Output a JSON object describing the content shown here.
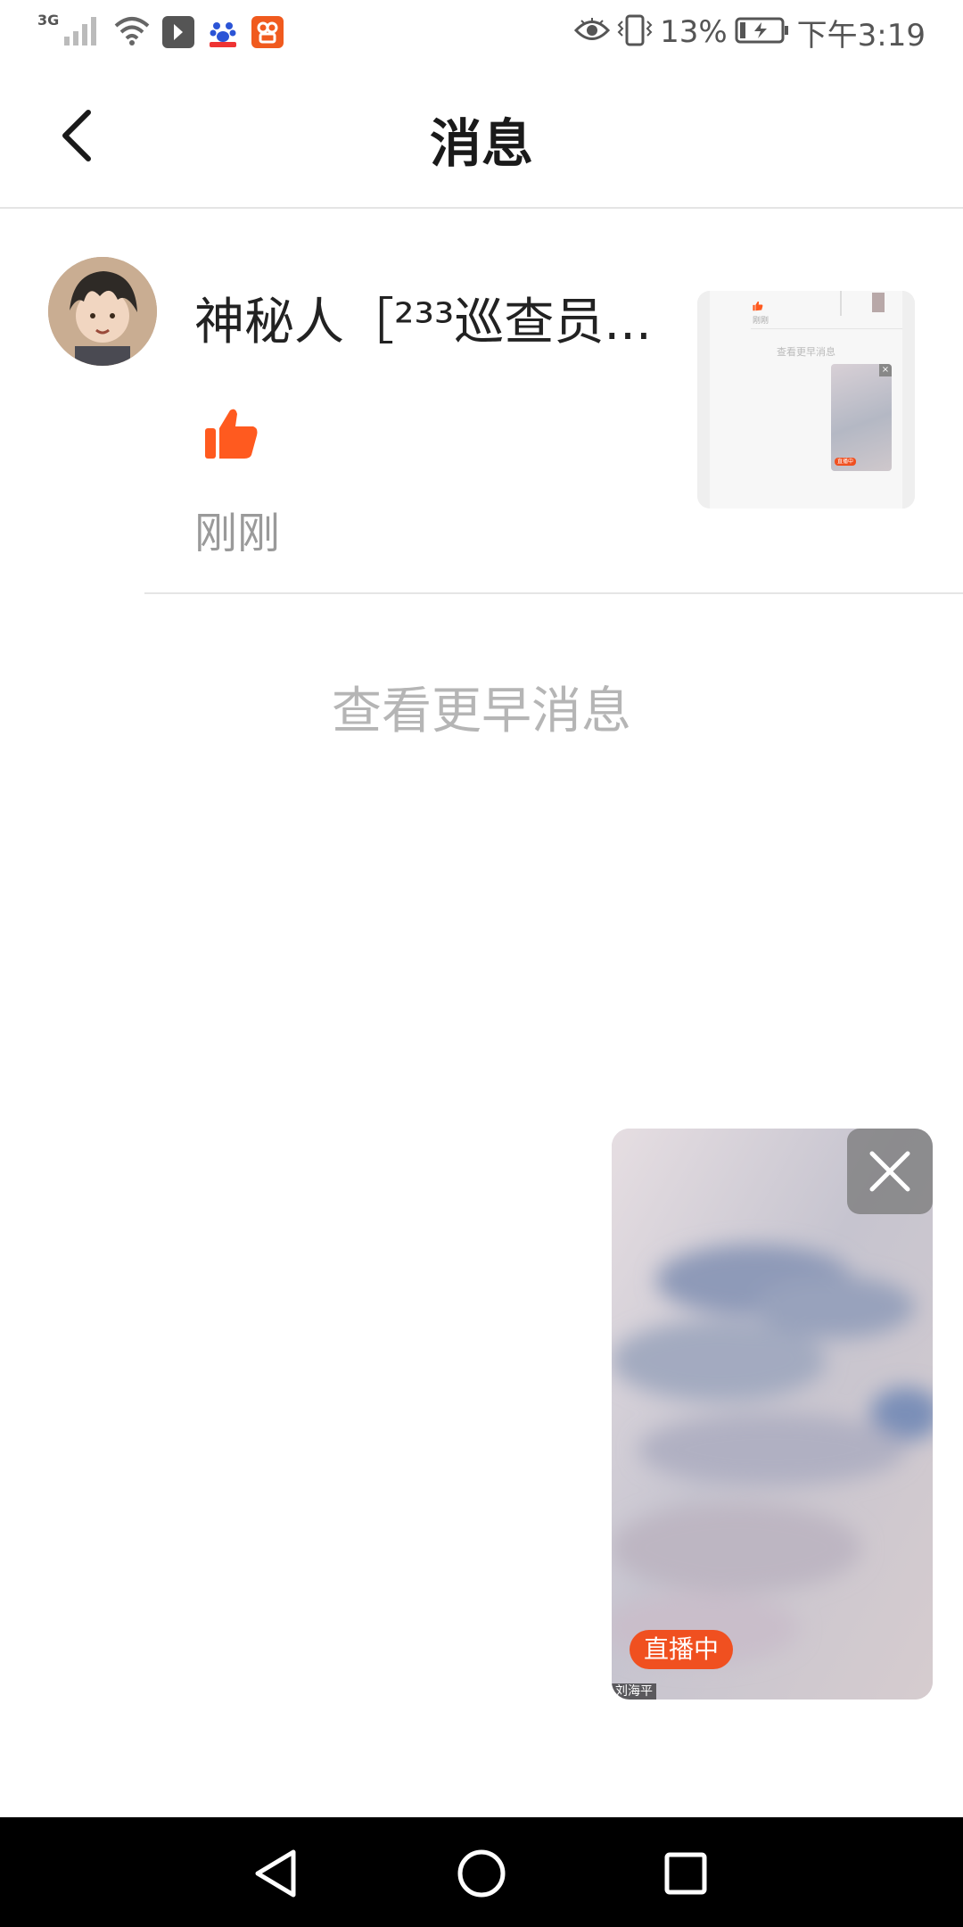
{
  "status_bar": {
    "network_type": "3G",
    "battery_percent": "13%",
    "time": "下午3:19",
    "icons": [
      "signal-icon",
      "wifi-icon",
      "app-icon-a",
      "baidu-icon",
      "app-icon-b",
      "eye-icon",
      "vibrate-icon",
      "battery-icon"
    ]
  },
  "header": {
    "title": "消息",
    "back_icon": "chevron-left-icon"
  },
  "messages": [
    {
      "name": "神秘人［²³³巡查员...",
      "action_icon": "thumbs-up-icon",
      "time": "刚刚",
      "thumbnail": {
        "time_text": "刚刚",
        "earlier_text": "查看更早消息",
        "live_text": "直播中"
      }
    }
  ],
  "earlier_messages_label": "查看更早消息",
  "floating_player": {
    "live_badge": "直播中",
    "host_name": "刘海平",
    "close_icon": "close-icon"
  },
  "nav_bar": {
    "back_icon": "triangle-back-icon",
    "home_icon": "circle-home-icon",
    "recents_icon": "square-recents-icon"
  },
  "colors": {
    "accent": "#ff5a1f",
    "title_text": "#1a1a1a",
    "secondary_text": "#9a9a9a",
    "divider": "#e5e5e5",
    "nav_bar": "#000000"
  }
}
